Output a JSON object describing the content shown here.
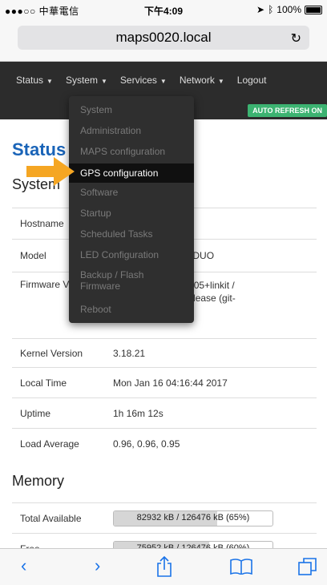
{
  "status_bar": {
    "carrier": "●●●○○ 中華電信",
    "time": "下午4:09",
    "battery": "100%"
  },
  "browser": {
    "url": "maps0020.local"
  },
  "nav": {
    "items": [
      "Status",
      "System",
      "Services",
      "Network",
      "Logout"
    ],
    "auto_refresh": "AUTO REFRESH ON"
  },
  "page": {
    "title": "Status",
    "system_heading": "System",
    "system_rows": [
      {
        "key": "Hostname",
        "value": ""
      },
      {
        "key": "Model",
        "value": "mart 7688 DUO"
      },
      {
        "key": "Firmware V",
        "value": "Calmer 15.05+linkit /\n42308c Release (git-\n1ff5b)"
      },
      {
        "key": "Kernel Version",
        "value": "3.18.21"
      },
      {
        "key": "Local Time",
        "value": "Mon Jan 16 04:16:44 2017"
      },
      {
        "key": "Uptime",
        "value": "1h 16m 12s"
      },
      {
        "key": "Load Average",
        "value": "0.96, 0.96, 0.95"
      }
    ],
    "memory_heading": "Memory",
    "memory_rows": [
      {
        "key": "Total Available",
        "bar_text": "82932 kB / 126476 kB (65%)",
        "fraction": 0.65
      },
      {
        "key": "Free",
        "bar_text": "75952 kB / 126476 kB (60%)",
        "fraction": 0.6
      }
    ]
  },
  "dropdown": {
    "items": [
      "System",
      "Administration",
      "MAPS configuration",
      "GPS configuration",
      "Software",
      "Startup",
      "Scheduled Tasks",
      "LED Configuration",
      "Backup / Flash\nFirmware",
      "Reboot"
    ],
    "active_index": 3
  },
  "colors": {
    "accent": "#1a64b8",
    "arrow": "#f5a623",
    "badge": "#3cb371"
  },
  "toolbar_icons": [
    "back-icon",
    "forward-icon",
    "share-icon",
    "bookmarks-icon",
    "tabs-icon"
  ]
}
